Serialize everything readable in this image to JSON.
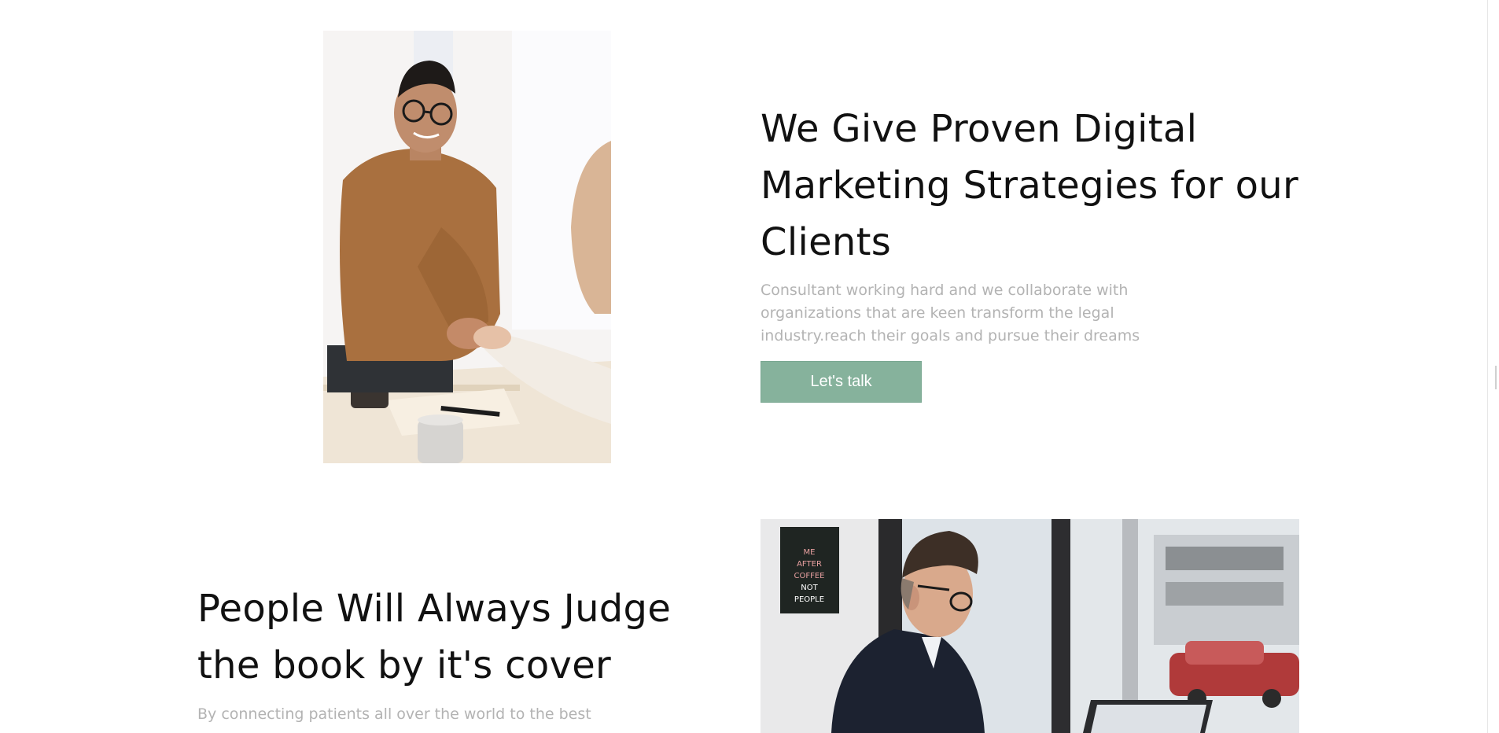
{
  "section_one": {
    "photo": {
      "icon": "handshake-meeting-photo"
    },
    "heading": "We Give Proven Digital Marketing Strategies for our Clients",
    "body": "Consultant working hard and we collaborate with organizations that are keen transform the legal industry.reach their goals and pursue their dreams",
    "cta_label": "Let's talk"
  },
  "section_two": {
    "photo": {
      "icon": "man-working-laptop-photo",
      "poster_text": "ME AFTER COFFEE NOT PEOPLE"
    },
    "heading": "People Will Always Judge the book by it's cover",
    "body": "By connecting patients all over the world to the best"
  },
  "colors": {
    "accent": "#86b29c",
    "heading": "#111111",
    "body_text": "#b3b3b3",
    "background": "#ffffff"
  }
}
